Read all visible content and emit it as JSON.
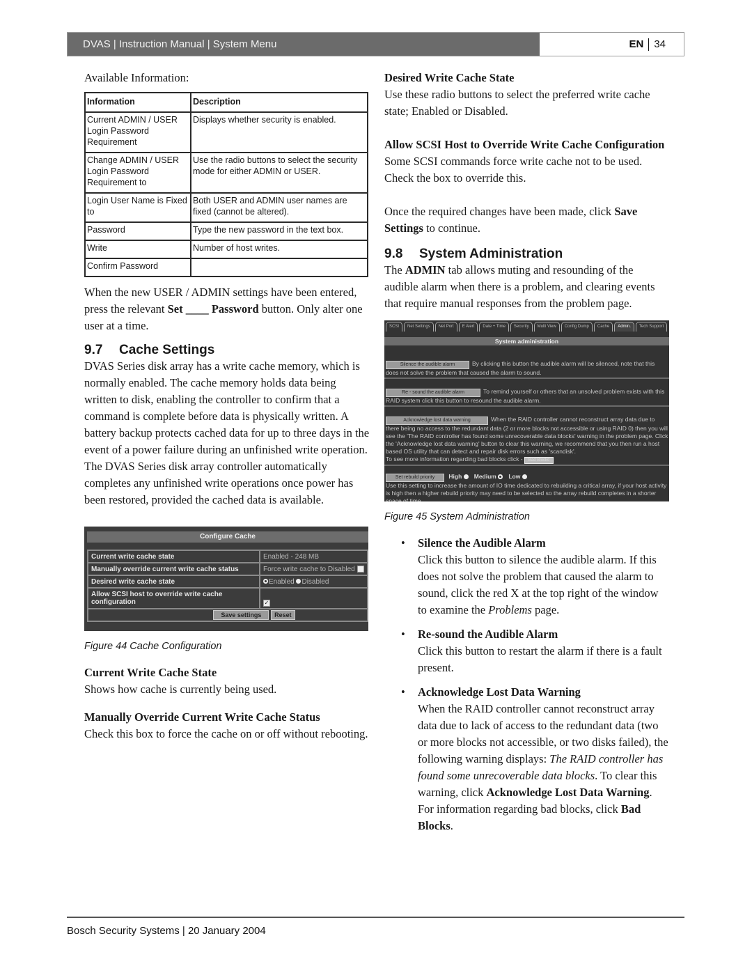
{
  "header": {
    "title": "DVAS | Instruction Manual | System Menu",
    "lang": "EN",
    "page_number": "34"
  },
  "left": {
    "available_label": "Available Information:",
    "table": {
      "headers": [
        "Information",
        "Description"
      ],
      "rows": [
        [
          "Current ADMIN / USER Login Password Requirement",
          "Displays whether security is enabled."
        ],
        [
          "Change ADMIN / USER Login Password Requirement to",
          "Use the radio buttons to select the security mode for either ADMIN or USER."
        ],
        [
          "Login User Name is Fixed to",
          "Both USER and ADMIN user names are fixed (cannot be altered)."
        ],
        [
          "Password",
          "Type the new password in the text box."
        ],
        [
          "Write",
          "Number of host writes."
        ],
        [
          "Confirm Password",
          ""
        ]
      ]
    },
    "after_table": {
      "p1": "When the new USER / ADMIN settings have been entered, press the relevant ",
      "b1": "Set ____ Password",
      "p2": " button. Only alter one user at a time."
    },
    "section": {
      "number": "9.7",
      "title": "Cache Settings"
    },
    "section_body": "DVAS Series disk array has a write cache memory, which is normally enabled. The cache memory holds data being written to disk, enabling the controller to confirm that a command is complete before data is physically written. A battery backup protects cached data for up to three days in the event of a power failure during an unfinished write operation. The DVAS Series disk array controller automatically completes any unfinished write operations once power has been restored, provided the cached data is available.",
    "figure": {
      "title": "Configure Cache",
      "rows": [
        {
          "label": "Current write cache state",
          "value": "Enabled - 248 MB"
        },
        {
          "label": "Manually override current write cache status",
          "value": "Force write cache to Disabled",
          "checked": false
        },
        {
          "label": "Desired write cache state",
          "options": [
            "Enabled",
            "Disabled"
          ],
          "selected": "Enabled"
        },
        {
          "label": "Allow SCSI host to override write cache configuration",
          "checked": true
        }
      ],
      "save_button": "Save settings",
      "reset_button": "Reset",
      "caption": "Figure 44  Cache Configuration"
    },
    "defs": [
      {
        "term": "Current Write Cache State",
        "desc": "Shows how cache is currently being used."
      },
      {
        "term": "Manually Override Current Write Cache Status",
        "desc": "Check this box to force the cache on or off without rebooting."
      }
    ]
  },
  "right": {
    "defs": [
      {
        "term": "Desired Write Cache State",
        "desc": "Use these radio buttons to select the preferred write cache state; Enabled or Disabled."
      },
      {
        "term": "Allow SCSI Host to Override Write Cache Configuration",
        "desc": "Some SCSI commands force write cache not to be used. Check the box to override this."
      }
    ],
    "once": {
      "p1": "Once the required changes have been made, click ",
      "b1": "Save Settings",
      "p2": " to continue."
    },
    "section": {
      "number": "9.8",
      "title": "System Administration"
    },
    "section_body": {
      "p1": "The ",
      "b1": "ADMIN",
      "p2": " tab allows muting and resounding of the audible alarm when there is a problem, and clearing events that require manual responses from the problem page."
    },
    "figure": {
      "tabs": [
        "SCSI",
        "Net Settings",
        "Net Port",
        "E Alert",
        "Date + Time",
        "Security",
        "Multi View",
        "Config Dump",
        "Cache",
        "Admin.",
        "Tech Support"
      ],
      "active_tab": "Admin.",
      "title": "System administration",
      "silence_button": "Silence the audible alarm",
      "silence_text": "By clicking this button the audible alarm will be silenced, note that this does not solve the problem that caused the alarm to sound.",
      "resound_button": "Re - sound the audible alarm",
      "resound_text": "To remind yourself or others that an unsolved problem exists with this RAID system click this button to resound the audible alarm.",
      "ack_button": "Acknowledge lost data warning",
      "ack_text": "When the RAID controller cannot reconstruct array data due to there being no access to the redundant data (2 or more blocks not accessible or using RAID 0) then you will see the 'The RAID controller has found some unrecoverable data blocks' warning in the problem page. Click the 'Acknowledge lost data warning' button to clear this warning, we recommend that you then run a host based OS utility that can detect and repair disk errors such as 'scandisk'.",
      "bad_blocks_text": "To see more information regarding bad blocks click -",
      "bad_blocks_button": "Bad Blocks",
      "rebuild_button": "Set rebuild priority",
      "rebuild_options": [
        "High",
        "Medium",
        "Low"
      ],
      "rebuild_selected": "Medium",
      "rebuild_text": "Use this setting to increase the amount of IO time dedicated to rebuilding a critical array, if your host activity is high then a higher rebuild priority may need to be selected so the array rebuild completes in a shorter space of time.",
      "caption": "Figure 45  System Administration"
    },
    "bullets": [
      {
        "term": "Silence the Audible Alarm",
        "p1": "Click this button to silence the audible alarm. If this does not solve the problem that caused the alarm to sound, click the red X at the top right of the window to examine the ",
        "i1": "Problems",
        "p2": " page."
      },
      {
        "term": "Re-sound the Audible Alarm",
        "p1": "Click this button to restart the alarm if there is a fault present."
      },
      {
        "term": "Acknowledge Lost Data Warning",
        "p1": "When the RAID controller cannot reconstruct array data due to lack of access to the redundant data (two or more blocks not accessible, or two disks failed), the following warning displays: ",
        "i1": "The RAID controller has found some unrecoverable data blocks",
        "p2": ". To clear this warning, click ",
        "b1": "Acknowledge Lost Data Warning",
        "p3": ". For information regarding bad blocks, click ",
        "b2": "Bad Blocks",
        "p4": "."
      }
    ]
  },
  "footer": {
    "text": "Bosch Security Systems | 20 January 2004"
  }
}
